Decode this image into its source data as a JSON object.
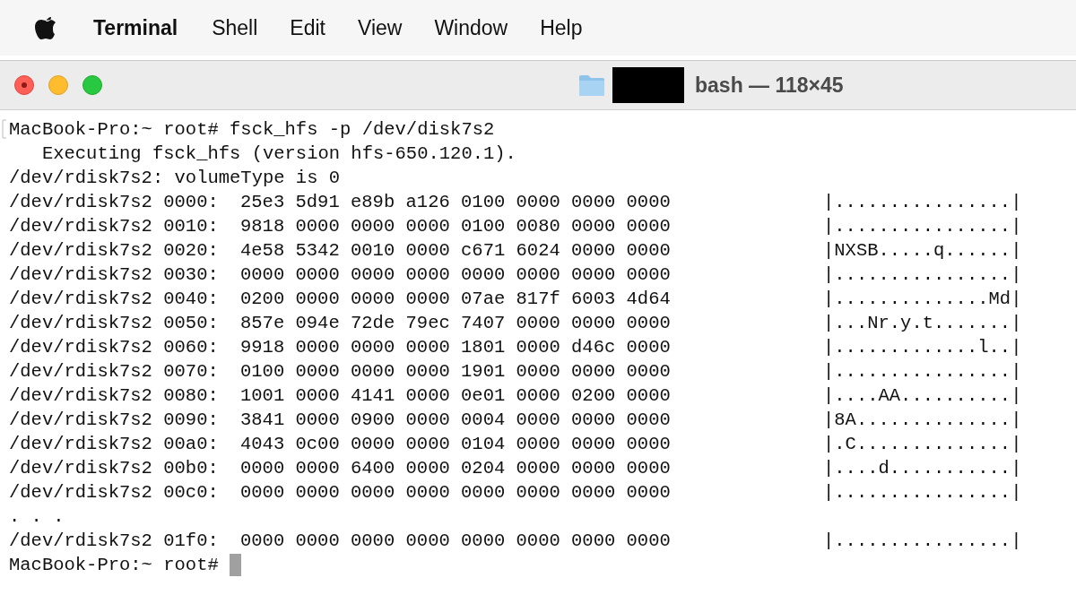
{
  "menu_bar": {
    "items": [
      {
        "label": "Terminal",
        "kind": "app"
      },
      {
        "label": "Shell",
        "kind": "menu"
      },
      {
        "label": "Edit",
        "kind": "menu"
      },
      {
        "label": "View",
        "kind": "menu"
      },
      {
        "label": "Window",
        "kind": "menu"
      },
      {
        "label": "Help",
        "kind": "menu"
      }
    ]
  },
  "window": {
    "title": "bash — 118×45",
    "redacted": true
  },
  "terminal": {
    "lines": [
      {
        "kind": "text",
        "text": "MacBook-Pro:~ root# fsck_hfs -p /dev/disk7s2",
        "marked": true
      },
      {
        "kind": "text",
        "text": "   Executing fsck_hfs (version hfs-650.120.1).",
        "marked": false
      },
      {
        "kind": "text",
        "text": "/dev/rdisk7s2: volumeType is 0",
        "marked": false
      },
      {
        "kind": "dump",
        "address": "/dev/rdisk7s2 0000:",
        "hex": "25e3 5d91 e89b a126 0100 0000 0000 0000",
        "ascii": "|................|"
      },
      {
        "kind": "dump",
        "address": "/dev/rdisk7s2 0010:",
        "hex": "9818 0000 0000 0000 0100 0080 0000 0000",
        "ascii": "|................|"
      },
      {
        "kind": "dump",
        "address": "/dev/rdisk7s2 0020:",
        "hex": "4e58 5342 0010 0000 c671 6024 0000 0000",
        "ascii": "|NXSB.....q......|"
      },
      {
        "kind": "dump",
        "address": "/dev/rdisk7s2 0030:",
        "hex": "0000 0000 0000 0000 0000 0000 0000 0000",
        "ascii": "|................|"
      },
      {
        "kind": "dump",
        "address": "/dev/rdisk7s2 0040:",
        "hex": "0200 0000 0000 0000 07ae 817f 6003 4d64",
        "ascii": "|..............Md|"
      },
      {
        "kind": "dump",
        "address": "/dev/rdisk7s2 0050:",
        "hex": "857e 094e 72de 79ec 7407 0000 0000 0000",
        "ascii": "|...Nr.y.t.......|"
      },
      {
        "kind": "dump",
        "address": "/dev/rdisk7s2 0060:",
        "hex": "9918 0000 0000 0000 1801 0000 d46c 0000",
        "ascii": "|.............l..|"
      },
      {
        "kind": "dump",
        "address": "/dev/rdisk7s2 0070:",
        "hex": "0100 0000 0000 0000 1901 0000 0000 0000",
        "ascii": "|................|"
      },
      {
        "kind": "dump",
        "address": "/dev/rdisk7s2 0080:",
        "hex": "1001 0000 4141 0000 0e01 0000 0200 0000",
        "ascii": "|....AA..........|"
      },
      {
        "kind": "dump",
        "address": "/dev/rdisk7s2 0090:",
        "hex": "3841 0000 0900 0000 0004 0000 0000 0000",
        "ascii": "|8A..............|"
      },
      {
        "kind": "dump",
        "address": "/dev/rdisk7s2 00a0:",
        "hex": "4043 0c00 0000 0000 0104 0000 0000 0000",
        "ascii": "|.C..............|"
      },
      {
        "kind": "dump",
        "address": "/dev/rdisk7s2 00b0:",
        "hex": "0000 0000 6400 0000 0204 0000 0000 0000",
        "ascii": "|....d...........|"
      },
      {
        "kind": "dump",
        "address": "/dev/rdisk7s2 00c0:",
        "hex": "0000 0000 0000 0000 0000 0000 0000 0000",
        "ascii": "|................|"
      },
      {
        "kind": "text",
        "text": ". . .",
        "marked": false
      },
      {
        "kind": "dump",
        "address": "/dev/rdisk7s2 01f0:",
        "hex": "0000 0000 0000 0000 0000 0000 0000 0000",
        "ascii": "|................|"
      },
      {
        "kind": "prompt",
        "text": "MacBook-Pro:~ root#"
      }
    ]
  }
}
